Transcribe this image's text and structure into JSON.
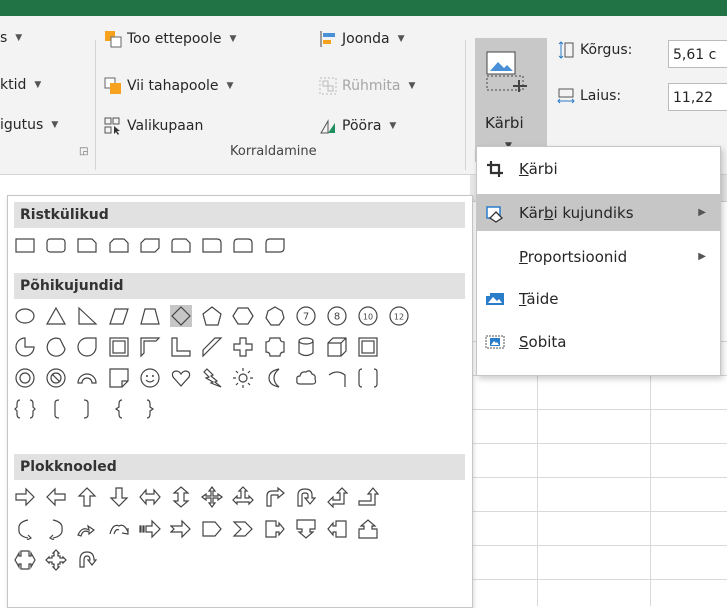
{
  "ribbon": {
    "left_items": [
      "s",
      "ktid",
      "igutus"
    ],
    "bring_forward": "Too ettepoole",
    "send_backward": "Vii tahapoole",
    "selection_pane": "Valikupaan",
    "align": "Joonda",
    "group": "Rühmita",
    "rotate": "Pööra",
    "arrange_group_label": "Korraldamine",
    "crop_label": "Kärbi",
    "height_label": "Kõrgus:",
    "height_value": "5,61 c",
    "width_label": "Laius:",
    "width_value": "11,22"
  },
  "crop_menu": {
    "items": [
      {
        "pre": "",
        "key": "K",
        "post": "ärbi",
        "icon": "crop-icon",
        "submenu": false
      },
      {
        "pre": "Kär",
        "key": "b",
        "post": "i kujundiks",
        "icon": "shape-crop-icon",
        "submenu": true
      },
      {
        "pre": "",
        "key": "P",
        "post": "roportsioonid",
        "icon": "",
        "submenu": true
      },
      {
        "pre": "",
        "key": "T",
        "post": "äide",
        "icon": "fill-icon",
        "submenu": false
      },
      {
        "pre": "",
        "key": "S",
        "post": "obita",
        "icon": "fit-icon",
        "submenu": false
      }
    ]
  },
  "shape_gallery": {
    "categories": [
      "Ristkülikud",
      "Põhikujundid",
      "Plokknooled"
    ],
    "number_shapes": [
      "7",
      "8",
      "10",
      "12"
    ],
    "selected_shape": "diamond"
  },
  "colors": {
    "accent": "#217346",
    "highlight": "#c6c6c6",
    "ribbon_bg": "#f3f3f3",
    "category_bg": "#e1e1e1"
  }
}
